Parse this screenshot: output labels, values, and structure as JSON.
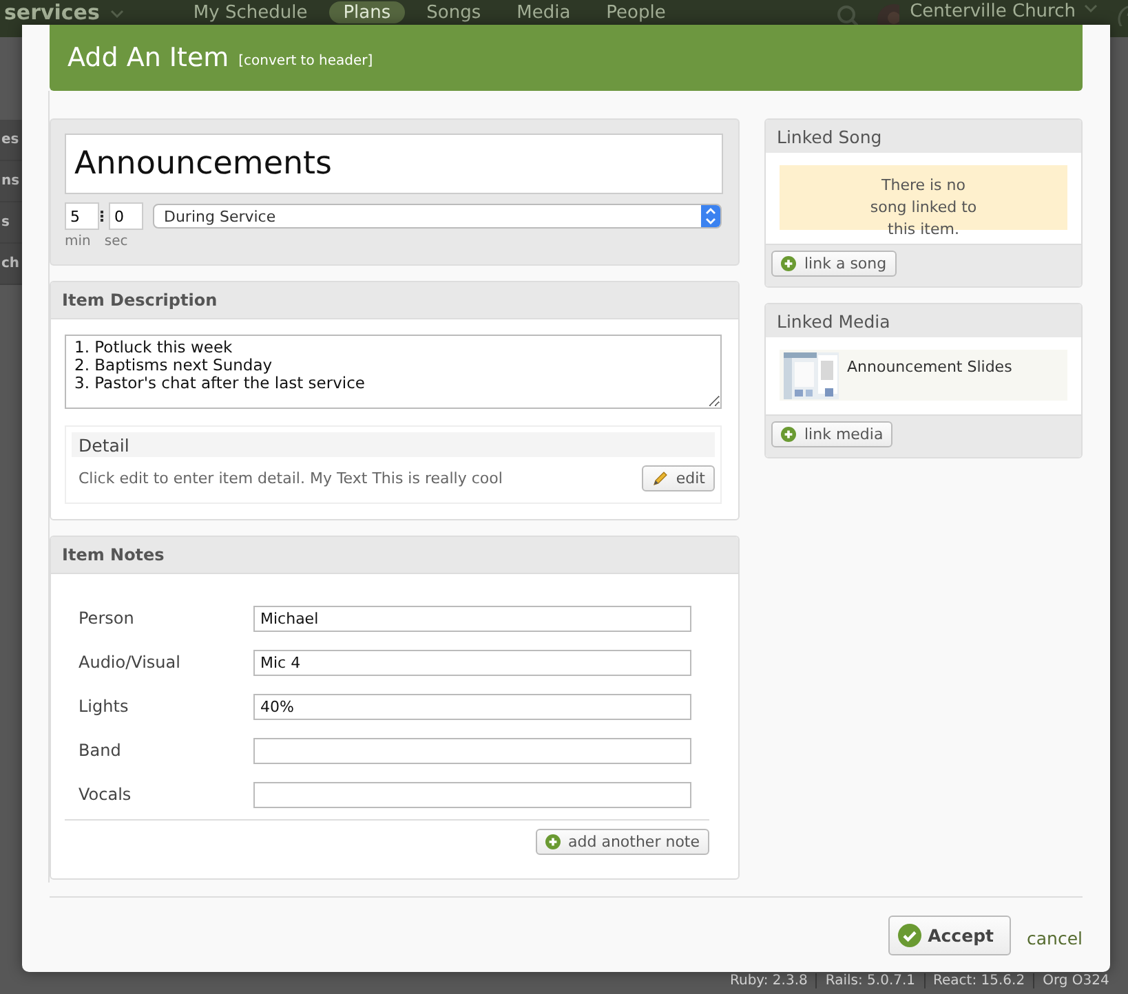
{
  "app_nav": {
    "brand": "services",
    "tabs": [
      {
        "label": "My Schedule",
        "selected": false
      },
      {
        "label": "Plans",
        "selected": true
      },
      {
        "label": "Songs",
        "selected": false
      },
      {
        "label": "Media",
        "selected": false
      },
      {
        "label": "People",
        "selected": false
      }
    ],
    "organization": "Centerville Church"
  },
  "sidebar": {
    "items": [
      "es",
      "ns",
      "s",
      "ch"
    ]
  },
  "footer": {
    "versions": [
      "Ruby: 2.3.8",
      "Rails: 5.0.7.1",
      "React: 15.6.2",
      "Org O324"
    ]
  },
  "dialog": {
    "title": "Add An Item",
    "title_link": "[convert to header]",
    "item": {
      "title": "Announcements",
      "minutes": "5",
      "seconds": "0",
      "minutes_label": "min",
      "seconds_label": "sec",
      "timing": "During Service"
    },
    "description": {
      "title": "Item Description",
      "text": "1. Potluck this week\n2. Baptisms next Sunday\n3. Pastor's chat after the last service",
      "detail_title": "Detail",
      "detail_text": "Click edit to enter item detail. My Text This is really cool",
      "edit_button": "edit"
    },
    "notes": {
      "title": "Item Notes",
      "rows": [
        {
          "label": "Person",
          "value": "Michael"
        },
        {
          "label": "Audio/Visual",
          "value": "Mic 4"
        },
        {
          "label": "Lights",
          "value": "40%"
        },
        {
          "label": "Band"
        },
        {
          "label": "Vocals"
        }
      ],
      "add_button": "add another note"
    },
    "linked_song": {
      "title": "Linked Song",
      "empty_message": "There is no song linked to this item.",
      "button": "link a song"
    },
    "linked_media": {
      "title": "Linked Media",
      "items": [
        {
          "name": "Announcement Slides",
          "kind": "picture"
        }
      ],
      "button": "link media"
    },
    "accept_button": "Accept",
    "cancel_link": "cancel"
  }
}
